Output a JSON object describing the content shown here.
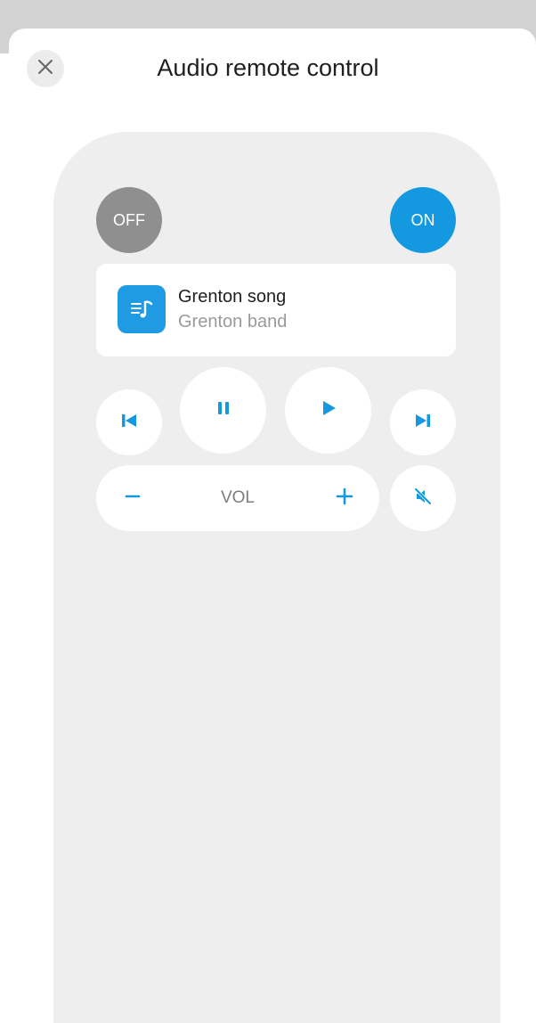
{
  "header": {
    "title": "Audio remote control",
    "close_icon": "close-icon"
  },
  "remote": {
    "off_label": "OFF",
    "on_label": "ON",
    "now_playing": {
      "title": "Grenton song",
      "artist": "Grenton band",
      "icon": "music-list-icon"
    },
    "controls": {
      "previous_icon": "skip-previous-icon",
      "pause_icon": "pause-icon",
      "play_icon": "play-icon",
      "next_icon": "skip-next-icon"
    },
    "volume": {
      "label": "VOL",
      "down_icon": "minus-icon",
      "up_icon": "plus-icon",
      "mute_icon": "mute-icon"
    }
  },
  "colors": {
    "accent": "#1498e0",
    "off_button": "#8f8f8f",
    "panel_background": "#eeeeee",
    "text_primary": "#1f1f1f",
    "text_secondary": "#9a9a9a"
  }
}
